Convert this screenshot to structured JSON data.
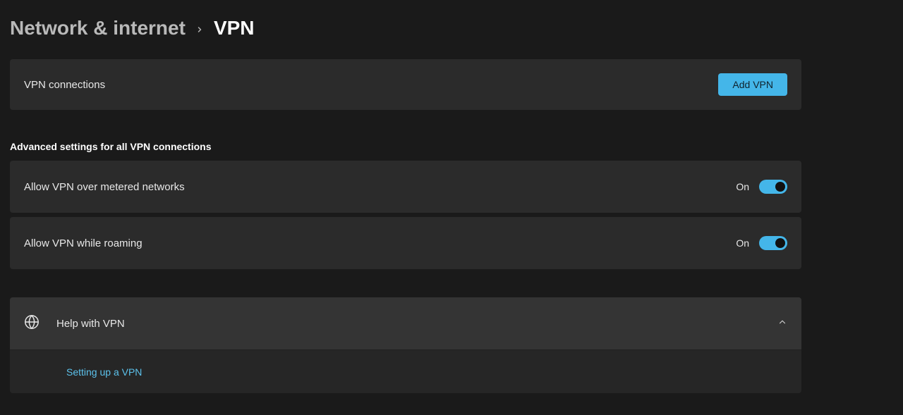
{
  "breadcrumb": {
    "parent": "Network & internet",
    "current": "VPN"
  },
  "vpn_connections": {
    "label": "VPN connections",
    "add_button": "Add VPN"
  },
  "advanced": {
    "header": "Advanced settings for all VPN connections",
    "metered": {
      "label": "Allow VPN over metered networks",
      "state": "On"
    },
    "roaming": {
      "label": "Allow VPN while roaming",
      "state": "On"
    }
  },
  "help": {
    "header": "Help with VPN",
    "link": "Setting up a VPN"
  }
}
